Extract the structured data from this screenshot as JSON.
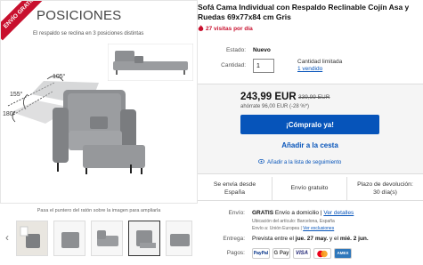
{
  "gallery": {
    "banner": "ENVÍO GRATIS",
    "heading": "POSICIONES",
    "subheading": "El respaldo se reclina en 3 posiciones distintas",
    "angles": [
      "105°",
      "155°",
      "180°"
    ],
    "hint": "Pasa el puntero del ratón sobre la imagen para ampliarla",
    "thumb_count": 5,
    "selected_thumb": 3
  },
  "listing": {
    "title": "Sofá Cama Individual con Respaldo Reclinable Cojín Asa y Ruedas 69x77x84 cm Gris",
    "watchers": "27 visitas por día",
    "condition_label": "Estado:",
    "condition_value": "Nuevo",
    "quantity_label": "Cantidad:",
    "quantity_value": "1",
    "availability": "Cantidad limitada",
    "sold": "1 vendido"
  },
  "buybox": {
    "price": "243,99 EUR",
    "was_price": "339,99 EUR",
    "savings": "ahórrate 96,00 EUR (-28 %*)",
    "buy_now": "¡Cómpralo ya!",
    "add_to_cart": "Añadir a la cesta",
    "watch": "Añadir a la lista de seguimiento"
  },
  "info": {
    "ships_from_1": "Se envía desde",
    "ships_from_2": "España",
    "free_shipping": "Envío gratuito",
    "returns_1": "Plazo de devolución:",
    "returns_2": "30 día(s)"
  },
  "shipping": {
    "label": "Envío:",
    "free": "GRATIS",
    "method": "Envío a domicilio",
    "details_link": "Ver detalles",
    "location": "Ubicación del artículo: Barcelona, España",
    "ships_to": "Envío a: Unión Europea",
    "exclusions_link": "Ver exclusiones",
    "delivery_label": "Entrega:",
    "delivery_prefix": "Prevista entre el",
    "delivery_from": "jue. 27 may.",
    "delivery_mid": "y el",
    "delivery_to": "mié. 2 jun.",
    "payments_label": "Pagos:",
    "payment_methods": [
      "PayPal",
      "G Pay",
      "VISA",
      "MC",
      "AMEX"
    ]
  },
  "colors": {
    "accent": "#0654ba",
    "alert": "#c8102e",
    "sofa": "#8d8f92"
  }
}
